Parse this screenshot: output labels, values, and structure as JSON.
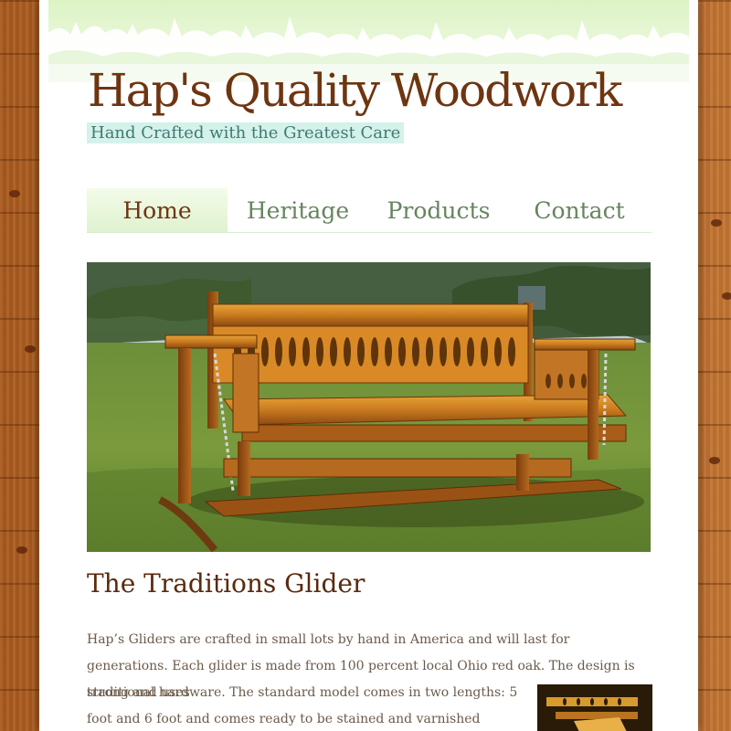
{
  "site": {
    "title": "Hap's Quality Woodwork",
    "tagline": "Hand Crafted with the Greatest Care"
  },
  "nav": {
    "items": [
      {
        "label": "Home",
        "active": true
      },
      {
        "label": "Heritage",
        "active": false
      },
      {
        "label": "Products",
        "active": false
      },
      {
        "label": "Contact",
        "active": false
      }
    ]
  },
  "main": {
    "hero_image": "glider-bench-photo",
    "heading": "The Traditions Glider",
    "paragraph_lines": [
      "Hap’s Gliders are crafted in small lots by hand in America and will last for generations. Each glider is made from 100 percent local Ohio red oak. The design is strong and uses",
      "traditional hardware. The standard model comes in two lengths: 5 foot and 6 foot and comes ready to be stained and varnished"
    ],
    "thumbnail_image": "glider-detail-thumbnail"
  },
  "colors": {
    "title": "#6e3511",
    "tagline_bg": "#d4f1ea",
    "tagline_text": "#3f7a74",
    "nav_text": "#67845f",
    "heading": "#5a2a0e",
    "body_text": "#6b5a4a",
    "wood_background": "#b9692b"
  }
}
